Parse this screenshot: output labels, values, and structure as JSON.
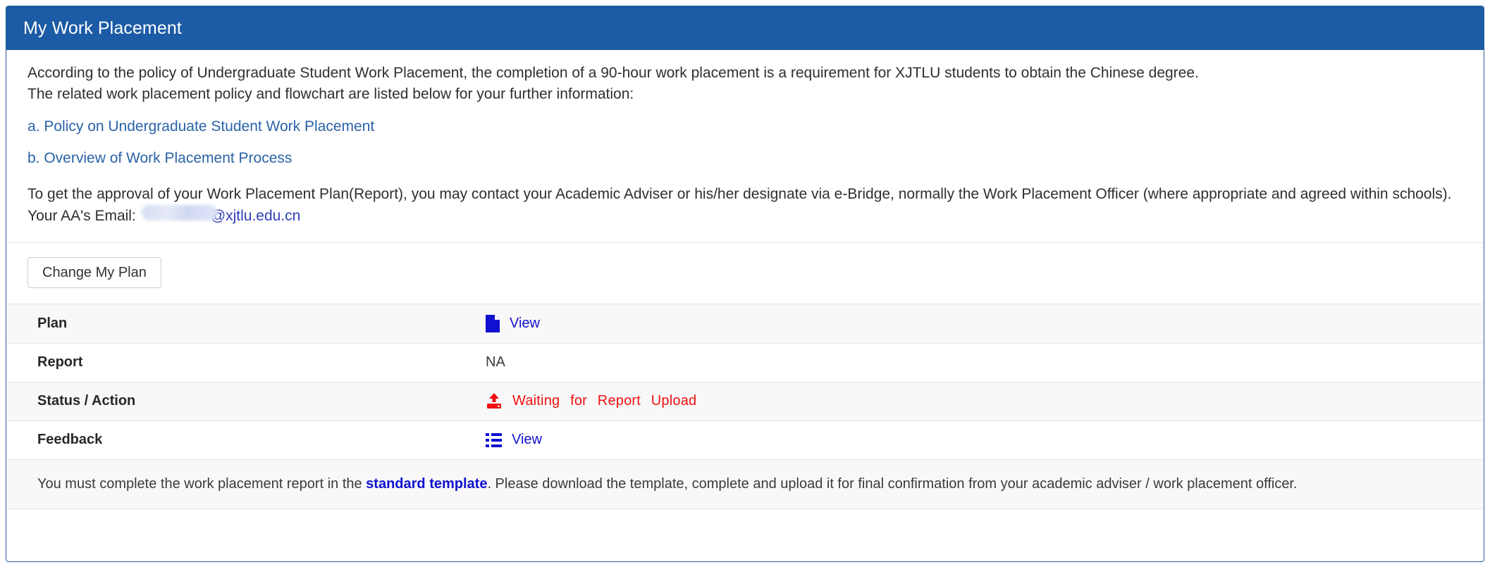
{
  "header": {
    "title": "My Work Placement"
  },
  "intro": {
    "line1": "According to the policy of Undergraduate Student Work Placement, the completion of a 90-hour work placement is a requirement for XJTLU students to obtain the Chinese degree.",
    "line2": "The related work placement policy and flowchart are listed below for your further information:",
    "links": [
      {
        "label": "a. Policy on Undergraduate Student Work Placement"
      },
      {
        "label": "b. Overview of Work Placement Process"
      }
    ],
    "approval_line": "To get the approval of your Work Placement Plan(Report), you may contact your Academic Adviser or his/her designate via e-Bridge, normally the Work Placement Officer (where appropriate and agreed within schools).",
    "email_label": "Your AA's Email:",
    "email_redacted": "",
    "email_suffix": "@xjtlu.edu.cn"
  },
  "actions": {
    "change_plan_label": "Change My Plan"
  },
  "table": {
    "rows": [
      {
        "label": "Plan",
        "value": "View",
        "icon": "file-icon",
        "type": "link"
      },
      {
        "label": "Report",
        "value": "NA",
        "icon": "",
        "type": "text"
      },
      {
        "label": "Status / Action",
        "value": "Waiting for Report Upload",
        "icon": "upload-icon",
        "type": "status"
      },
      {
        "label": "Feedback",
        "value": "View",
        "icon": "list-icon",
        "type": "link"
      }
    ]
  },
  "footnote": {
    "before": "You must complete the work placement report in the ",
    "link": "standard template",
    "after": ". Please download the template, complete and upload it for final confirmation from your academic adviser / work placement officer."
  },
  "colors": {
    "header_blue": "#1c5ba5",
    "link_blue": "#2a63a8",
    "action_blue": "#1010d0",
    "status_red": "#f01010",
    "panel_border": "#2a6099",
    "row_stripe": "#f8f8f8"
  }
}
